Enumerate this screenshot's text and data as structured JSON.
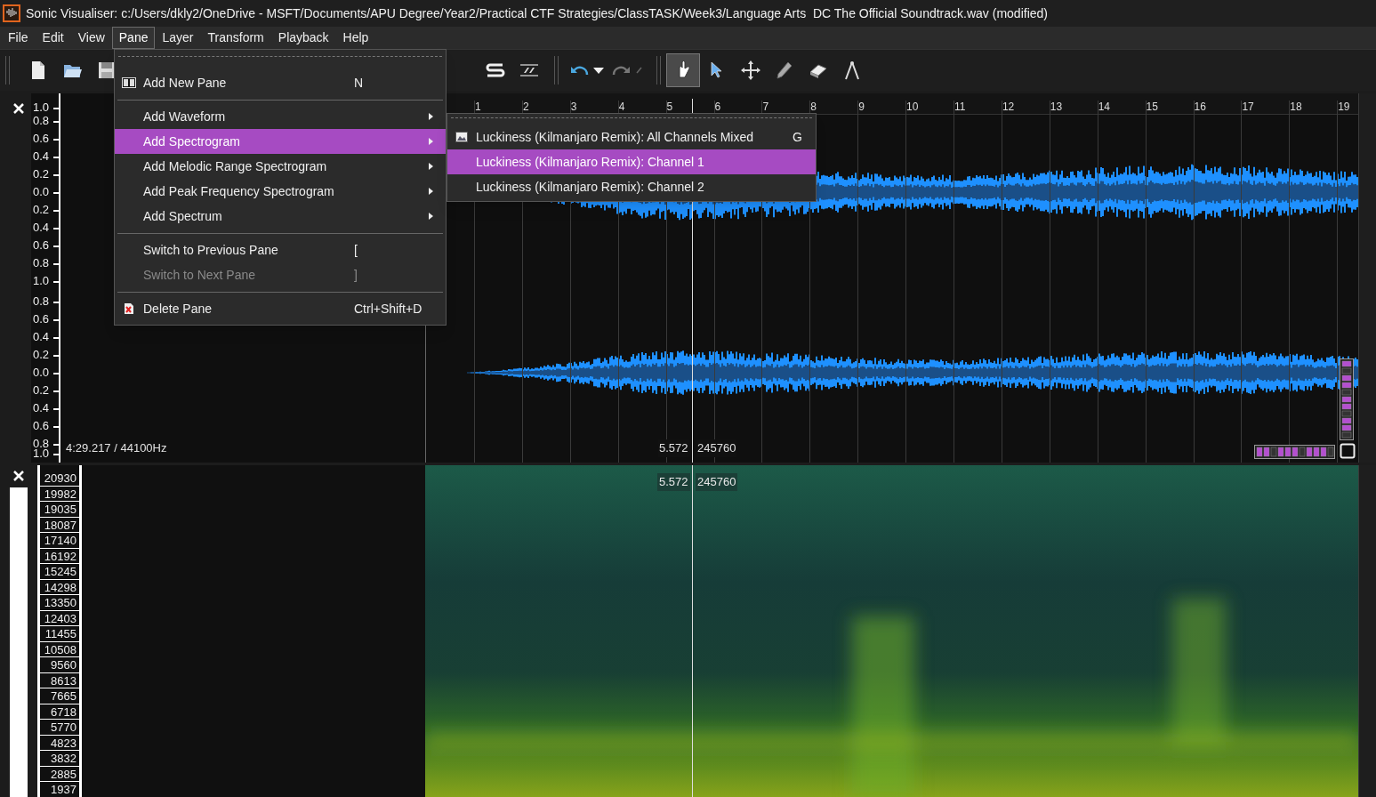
{
  "window": {
    "title": "Sonic Visualiser: c:/Users/dkly2/OneDrive - MSFT/Documents/APU Degree/Year2/Practical CTF Strategies/ClassTASK/Week3/Language Arts  DC The Official Soundtrack.wav (modified)"
  },
  "menubar": [
    {
      "label": "File",
      "selected": false
    },
    {
      "label": "Edit",
      "selected": false
    },
    {
      "label": "View",
      "selected": false
    },
    {
      "label": "Pane",
      "selected": true
    },
    {
      "label": "Layer",
      "selected": false
    },
    {
      "label": "Transform",
      "selected": false
    },
    {
      "label": "Playback",
      "selected": false
    },
    {
      "label": "Help",
      "selected": false
    }
  ],
  "history": [
    {
      "kind": "undo",
      "disabled": false
    },
    {
      "kind": "redo",
      "disabled": true
    }
  ],
  "tools": [
    {
      "kind": "navigate",
      "selected": true
    },
    {
      "kind": "select",
      "selected": false
    },
    {
      "kind": "move",
      "selected": false
    },
    {
      "kind": "draw",
      "selected": false
    },
    {
      "kind": "erase",
      "selected": false
    },
    {
      "kind": "measure",
      "selected": false
    }
  ],
  "pane_menu": [
    {
      "kind": "add",
      "label": "Add New Pane",
      "shortcut": "N",
      "selected": false,
      "disabled": false
    },
    {
      "kind": "separator"
    },
    {
      "kind": "submenu",
      "label": "Add Waveform",
      "selected": false,
      "disabled": false
    },
    {
      "kind": "submenu",
      "label": "Add Spectrogram",
      "selected": true,
      "disabled": false
    },
    {
      "kind": "submenu",
      "label": "Add Melodic Range Spectrogram",
      "selected": false,
      "disabled": false
    },
    {
      "kind": "submenu",
      "label": "Add Peak Frequency Spectrogram",
      "selected": false,
      "disabled": false
    },
    {
      "kind": "submenu",
      "label": "Add Spectrum",
      "selected": false,
      "disabled": false
    },
    {
      "kind": "separator"
    },
    {
      "kind": "action",
      "label": "Switch to Previous Pane",
      "shortcut": "[",
      "selected": false,
      "disabled": false
    },
    {
      "kind": "action",
      "label": "Switch to Next Pane",
      "shortcut": "]",
      "selected": false,
      "disabled": true
    },
    {
      "kind": "separator"
    },
    {
      "kind": "remove",
      "label": "Delete Pane",
      "shortcut": "Ctrl+Shift+D",
      "selected": false,
      "disabled": false
    }
  ],
  "submenu": [
    {
      "label": "Luckiness (Kilmanjaro Remix): All Channels Mixed",
      "shortcut": "G",
      "selected": false,
      "icon": true
    },
    {
      "label": "Luckiness (Kilmanjaro Remix): Channel 1",
      "selected": true,
      "icon": false
    },
    {
      "label": "Luckiness (Kilmanjaro Remix): Channel 2",
      "selected": false,
      "icon": false
    }
  ],
  "waveform_pane": {
    "scale_labels": [
      "1.0",
      "0.8",
      "0.6",
      "0.4",
      "0.2",
      "0.0",
      "0.2",
      "0.4",
      "0.6",
      "0.8",
      "1.0",
      "0.8",
      "0.6",
      "0.4",
      "0.2",
      "0.0",
      "0.2",
      "0.4",
      "0.6",
      "0.8",
      "1.0"
    ],
    "ruler": [
      "1",
      "2",
      "3",
      "4",
      "5",
      "6",
      "7",
      "8",
      "9",
      "10",
      "11",
      "12",
      "13",
      "14",
      "15",
      "16",
      "17",
      "18",
      "19"
    ],
    "duration": "4:29.217 / 44100Hz",
    "cursor_time": "5.572",
    "cursor_frame": "245760"
  },
  "spectrogram_pane": {
    "frequency_labels": [
      "20930",
      "19982",
      "19035",
      "18087",
      "17140",
      "16192",
      "15245",
      "14298",
      "13350",
      "12403",
      "11455",
      "10508",
      "9560",
      "8613",
      "7665",
      "6718",
      "5770",
      "4823",
      "3832",
      "2885",
      "1937"
    ],
    "cursor_time": "5.572",
    "cursor_frame": "245760"
  }
}
